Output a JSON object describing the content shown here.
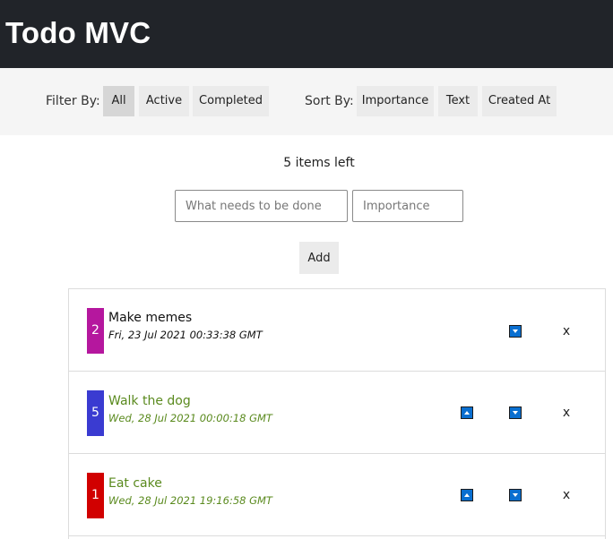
{
  "header": {
    "title": "Todo MVC"
  },
  "filter": {
    "label": "Filter By:",
    "options": [
      "All",
      "Active",
      "Completed"
    ],
    "selected": "All"
  },
  "sort": {
    "label": "Sort By:",
    "options": [
      "Importance",
      "Text",
      "Created At"
    ]
  },
  "status": {
    "items_left": "5 items left"
  },
  "form": {
    "text_placeholder": "What needs to be done",
    "importance_placeholder": "Importance",
    "add_label": "Add"
  },
  "todos": [
    {
      "importance": "2",
      "text": "Make memes",
      "created": "Fri, 23 Jul 2021 00:33:38 GMT",
      "completed": false,
      "importance_color": "#b5179e",
      "has_up": false,
      "has_down": true
    },
    {
      "importance": "5",
      "text": "Walk the dog",
      "created": "Wed, 28 Jul 2021 00:00:18 GMT",
      "completed": true,
      "importance_color": "#3a3bd1",
      "has_up": true,
      "has_down": true
    },
    {
      "importance": "1",
      "text": "Eat cake",
      "created": "Wed, 28 Jul 2021 19:16:58 GMT",
      "completed": true,
      "importance_color": "#d10000",
      "has_up": true,
      "has_down": true
    }
  ],
  "delete_label": "x",
  "colors": {
    "header_bg": "#212429",
    "completed_text": "#5a8a1e",
    "active_text": "#111111",
    "arrow_bg": "#0a6fd0"
  },
  "icons": {
    "move_up": "triangle-up-icon",
    "move_down": "triangle-down-icon"
  }
}
